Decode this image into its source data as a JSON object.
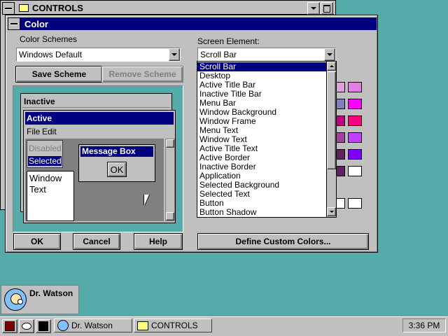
{
  "controls_window": {
    "title": "CONTROLS"
  },
  "color_dialog": {
    "title": "Color",
    "color_schemes": {
      "group_label": "Color Schemes",
      "value": "Windows Default"
    },
    "save_scheme": "Save Scheme",
    "remove_scheme": "Remove Scheme",
    "preview": {
      "inactive_title": "Inactive",
      "active_title": "Active",
      "menu": [
        "File",
        "Edit"
      ],
      "disabled": "Disabled",
      "selected": "Selected",
      "window_text": "Window Text",
      "message_box_title": "Message Box",
      "message_ok": "OK"
    },
    "screen_element": {
      "label": "Screen Element:",
      "value": "Scroll Bar",
      "items": [
        "Scroll Bar",
        "Desktop",
        "Active Title Bar",
        "Inactive Title Bar",
        "Menu Bar",
        "Window Background",
        "Window Frame",
        "Menu Text",
        "Window Text",
        "Active Title Text",
        "Active Border",
        "Inactive Border",
        "Application",
        "Selected Background",
        "Selected Text",
        "Button",
        "Button Shadow"
      ]
    },
    "ok": "OK",
    "cancel": "Cancel",
    "help": "Help",
    "define_custom": "Define Custom Colors...",
    "palette_colors": [
      "#e080e0",
      "#ff00ff",
      "#ff0080",
      "#c040ff",
      "#8000ff",
      "#ffffff"
    ],
    "accent_colors": {
      "title": "#000080",
      "desktop": "#55aaaa",
      "face": "#c0c0c0"
    }
  },
  "desktop_icon": {
    "label": "Dr. Watson",
    "icon": "dr-watson-icon"
  },
  "taskbar": {
    "tasks": [
      "Dr. Watson",
      "CONTROLS"
    ],
    "clock": "3:36 PM"
  }
}
